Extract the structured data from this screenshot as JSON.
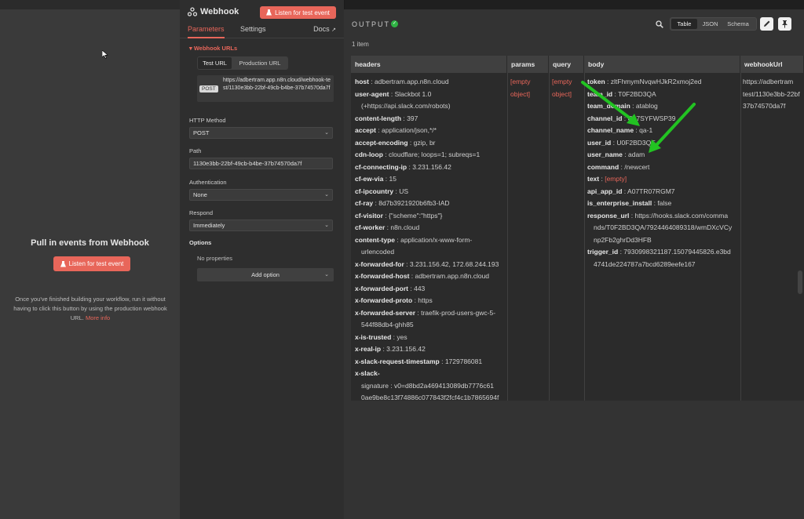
{
  "input_pane": {
    "title": "Pull in events from Webhook",
    "listen_button": "Listen for test event",
    "help_text": "Once you've finished building your workflow, run it without having to click this button by using the production webhook URL.",
    "help_link": "More info"
  },
  "node": {
    "title": "Webhook",
    "listen_button": "Listen for test event",
    "tabs": [
      {
        "label": "Parameters"
      },
      {
        "label": "Settings"
      },
      {
        "label": "Docs"
      }
    ],
    "webhook_urls_label": "Webhook URLs",
    "url_toggle": [
      "Test URL",
      "Production URL"
    ],
    "url_method": "POST",
    "url": "https://adbertram.app.n8n.cloud/webhook-test/1130e3bb-22bf-49cb-b4be-37b74570da7f",
    "fields": {
      "http_method": {
        "label": "HTTP Method",
        "value": "POST"
      },
      "path": {
        "label": "Path",
        "value": "1130e3bb-22bf-49cb-b4be-37b74570da7f"
      },
      "authentication": {
        "label": "Authentication",
        "value": "None"
      },
      "respond": {
        "label": "Respond",
        "value": "Immediately"
      }
    },
    "options_label": "Options",
    "no_properties": "No properties",
    "add_option": "Add option"
  },
  "output": {
    "title": "OUTPUT",
    "item_count": "1 item",
    "views": [
      "Table",
      "JSON",
      "Schema"
    ],
    "columns": [
      "headers",
      "params",
      "query",
      "body",
      "webhookUrl"
    ],
    "headers": [
      {
        "k": "host",
        "v": "adbertram.app.n8n.cloud"
      },
      {
        "k": "user-agent",
        "v": "Slackbot 1.0",
        "cont": "(+https://api.slack.com/robots)"
      },
      {
        "k": "content-length",
        "v": "397"
      },
      {
        "k": "accept",
        "v": "application/json,*/*"
      },
      {
        "k": "accept-encoding",
        "v": "gzip, br"
      },
      {
        "k": "cdn-loop",
        "v": "cloudflare; loops=1; subreqs=1"
      },
      {
        "k": "cf-connecting-ip",
        "v": "3.231.156.42"
      },
      {
        "k": "cf-ew-via",
        "v": "15"
      },
      {
        "k": "cf-ipcountry",
        "v": "US"
      },
      {
        "k": "cf-ray",
        "v": "8d7b3921920b6fb3-IAD"
      },
      {
        "k": "cf-visitor",
        "v": "{\"scheme\":\"https\"}"
      },
      {
        "k": "cf-worker",
        "v": "n8n.cloud"
      },
      {
        "k": "content-type",
        "v": "application/x-www-form-",
        "cont": "urlencoded"
      },
      {
        "k": "x-forwarded-for",
        "v": "3.231.156.42, 172.68.244.193"
      },
      {
        "k": "x-forwarded-host",
        "v": "adbertram.app.n8n.cloud"
      },
      {
        "k": "x-forwarded-port",
        "v": "443"
      },
      {
        "k": "x-forwarded-proto",
        "v": "https"
      },
      {
        "k": "x-forwarded-server",
        "v": "traefik-prod-users-gwc-5-",
        "cont": "544f88db4-ghh85"
      },
      {
        "k": "x-is-trusted",
        "v": "yes"
      },
      {
        "k": "x-real-ip",
        "v": "3.231.156.42"
      },
      {
        "k": "x-slack-request-timestamp",
        "v": "1729786081"
      },
      {
        "k": "x-slack-",
        "v": "",
        "cont": "signature : v0=d8bd2a469413089db7776c61",
        "cont2": "0ae9be8c13f74886c077843f2fcf4c1b7865694f"
      }
    ],
    "params": "[empty object]",
    "query": "[empty object]",
    "body": [
      {
        "k": "token",
        "v": "zltFhmymNvqwHJkR2xmoj2ed"
      },
      {
        "k": "team_id",
        "v": "T0F2BD3QA"
      },
      {
        "k": "team_domain",
        "v": "atablog"
      },
      {
        "k": "channel_id",
        "v": "C07SYFWSP39"
      },
      {
        "k": "channel_name",
        "v": "qa-1"
      },
      {
        "k": "user_id",
        "v": "U0F2BD3QE"
      },
      {
        "k": "user_name",
        "v": "adam"
      },
      {
        "k": "command",
        "v": "/newcert"
      },
      {
        "k": "text",
        "v": "[empty]",
        "empty": true
      },
      {
        "k": "api_app_id",
        "v": "A07TR07RGM7"
      },
      {
        "k": "is_enterprise_install",
        "v": "false"
      },
      {
        "k": "response_url",
        "v": "https://hooks.slack.com/comma",
        "cont": "nds/T0F2BD3QA/7924464089318/wmDXcVCy",
        "cont2": "np2Fb2ghrDd3HFB"
      },
      {
        "k": "trigger_id",
        "v": "7930998321187.15079445826.e3bd",
        "cont": "4741de224787a7bcd6289eefe167"
      }
    ],
    "webhook_url": "https://adbertram.app.n8n.cloud/webhook-test/1130e3bb-22bf-49cb-b4be-37b74570da7f",
    "webhook_url_lines": [
      "https://adbertram",
      "test/1130e3bb-22bf",
      "37b74570da7f"
    ]
  },
  "colors": {
    "accent": "#e8665a",
    "arrow": "#22c322",
    "success": "#2fb344"
  }
}
